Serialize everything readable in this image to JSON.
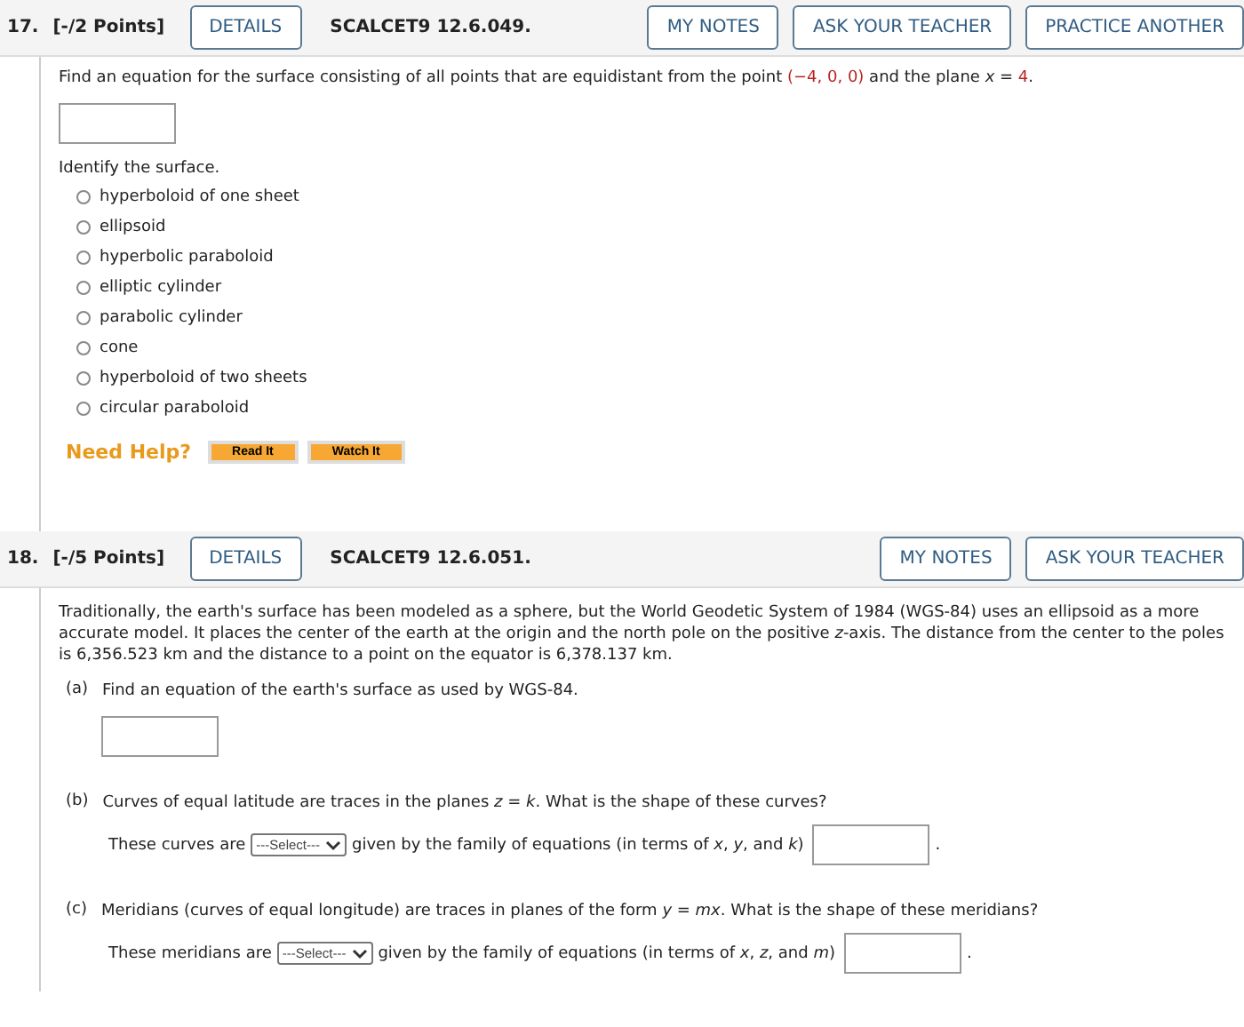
{
  "questions": [
    {
      "number": "17.",
      "points": "[-/2 Points]",
      "details": "DETAILS",
      "code": "SCALCET9 12.6.049.",
      "actions": [
        "MY NOTES",
        "ASK YOUR TEACHER",
        "PRACTICE ANOTHER"
      ],
      "prompt": [
        {
          "kind": "text",
          "s": "Find an equation for the surface consisting of all points that are equidistant from the point "
        },
        {
          "kind": "value",
          "s": "(−4, 0, 0)"
        },
        {
          "kind": "text",
          "s": " and the plane *x* = "
        },
        {
          "kind": "value",
          "s": "4"
        },
        {
          "kind": "text",
          "s": "."
        }
      ],
      "identify": "Identify the surface.",
      "options": [
        {
          "label": "hyperboloid of one sheet",
          "selected": false
        },
        {
          "label": "ellipsoid",
          "selected": false
        },
        {
          "label": "hyperbolic paraboloid",
          "selected": false
        },
        {
          "label": "elliptic cylinder",
          "selected": false
        },
        {
          "label": "parabolic cylinder",
          "selected": false
        },
        {
          "label": "cone",
          "selected": false
        },
        {
          "label": "hyperboloid of two sheets",
          "selected": false
        },
        {
          "label": "circular paraboloid",
          "selected": false
        }
      ],
      "need_help": "Need Help?",
      "help_buttons": [
        "Read It",
        "Watch It"
      ]
    },
    {
      "number": "18.",
      "points": "[-/5 Points]",
      "details": "DETAILS",
      "code": "SCALCET9 12.6.051.",
      "actions": [
        "MY NOTES",
        "ASK YOUR TEACHER"
      ],
      "intro": "Traditionally, the earth's surface has been modeled as a sphere, but the World Geodetic System of 1984 (WGS-84) uses an ellipsoid as a more accurate model. It places the center of the earth at the origin and the north pole on the positive *z*-axis. The distance from the center to the poles is 6,356.523 km and the distance to a point on the equator is 6,378.137 km.",
      "parts": [
        {
          "kind": "box",
          "label": "(a)",
          "question": "Find an equation of the earth's surface as used by WGS-84."
        },
        {
          "kind": "select",
          "label": "(b)",
          "question": "Curves of equal latitude are traces in the planes *z* = *k*. What is the shape of these curves?",
          "before": "These curves are",
          "select": "---Select---",
          "after": "given by the family of equations (in terms of *x*, *y*, and *k*)",
          "end": "."
        },
        {
          "kind": "select",
          "label": "(c)",
          "question": "Meridians (curves of equal longitude) are traces in planes of the form *y* = *mx*. What is the shape of these meridians?",
          "before": "These meridians are",
          "select": "---Select---",
          "after": "given by the family of equations (in terms of *x*, *z*, and *m*)",
          "end": "."
        }
      ]
    }
  ]
}
